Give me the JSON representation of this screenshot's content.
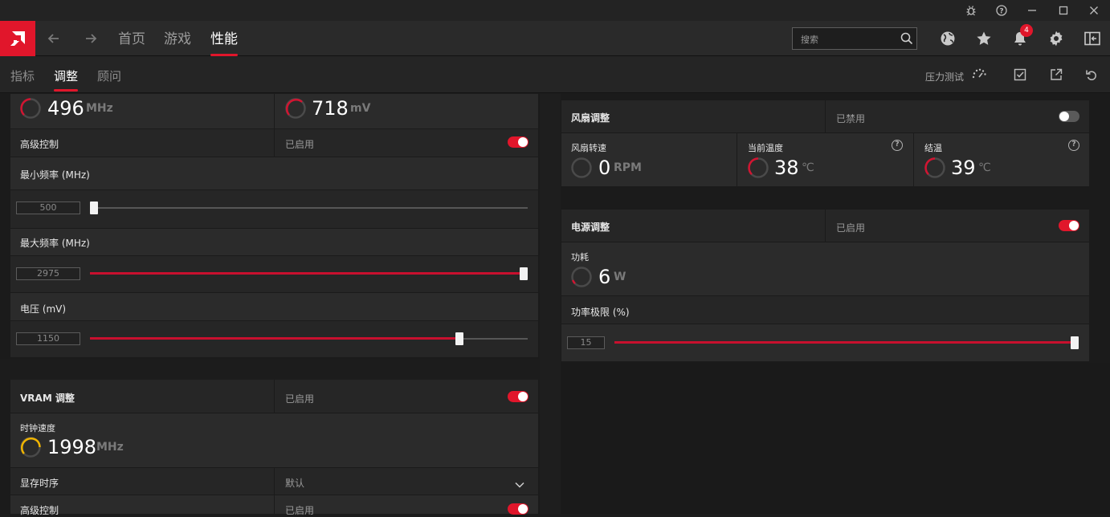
{
  "nav": {
    "tabs": [
      "首页",
      "游戏",
      "性能"
    ],
    "active_tab": "性能",
    "search_placeholder": "搜索",
    "notification_count": "4"
  },
  "subnav": {
    "tabs": [
      "指标",
      "调整",
      "顾问"
    ],
    "active_tab": "调整",
    "stress_test_label": "压力测试"
  },
  "gpu": {
    "clock_value": "496",
    "clock_unit": "MHz",
    "voltage_value": "718",
    "voltage_unit": "mV",
    "advanced_label": "高级控制",
    "advanced_state": "已启用",
    "min_freq_label": "最小频率 (MHz)",
    "min_freq_value": "500",
    "min_freq_fraction": 0.0,
    "max_freq_label": "最大频率 (MHz)",
    "max_freq_value": "2975",
    "max_freq_fraction": 1.0,
    "voltage_label": "电压 (mV)",
    "voltage_slider_value": "1150",
    "voltage_slider_fraction": 0.85
  },
  "vram": {
    "title": "VRAM 调整",
    "state": "已启用",
    "clock_label": "时钟速度",
    "clock_value": "1998",
    "clock_unit": "MHz",
    "timing_label": "显存时序",
    "timing_value": "默认",
    "advanced_label": "高级控制",
    "advanced_state": "已启用"
  },
  "fan": {
    "title": "风扇调整",
    "state": "已禁用",
    "speed_label": "风扇转速",
    "speed_value": "0",
    "speed_unit": "RPM",
    "temp_label": "当前温度",
    "temp_value": "38",
    "temp_unit": "℃",
    "junction_label": "结温",
    "junction_value": "39",
    "junction_unit": "℃"
  },
  "power": {
    "title": "电源调整",
    "state": "已启用",
    "consumption_label": "功耗",
    "consumption_value": "6",
    "consumption_unit": "W",
    "limit_label": "功率极限 (%)",
    "limit_value": "15",
    "limit_fraction": 1.0
  },
  "colors": {
    "accent": "#e1162b",
    "vram_gauge": "#f0b400"
  }
}
